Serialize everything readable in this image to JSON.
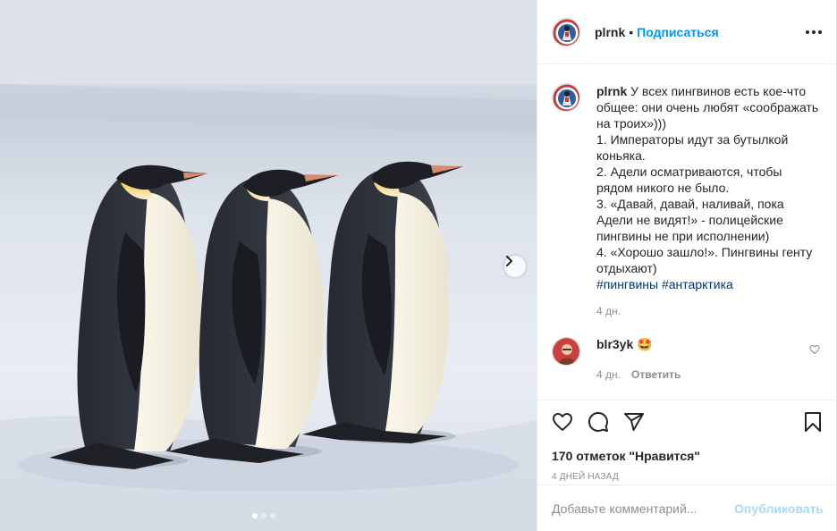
{
  "post": {
    "username": "plrnk",
    "separator": "•",
    "follow_label": "Подписаться",
    "more_label": "Дополнительно"
  },
  "caption": {
    "username": "plrnk",
    "lines": [
      "У всех пингвинов есть кое-что общее: они очень любят «соображать на троих»)))",
      "1. Императоры идут за бутылкой коньяка.",
      "2. Адели осматриваются, чтобы рядом никого не было.",
      "3. «Давай, давай, наливай, пока Адели не видят!» - полицейские пингвины не при исполнении)",
      "4. «Хорошо зашло!». Пингвины генту отдыхают)"
    ],
    "hashtags": [
      "#пингвины",
      "#антарктика"
    ],
    "time": "4 дн."
  },
  "comment": {
    "username": "blr3yk",
    "emoji": "🤩",
    "time": "4 дн.",
    "reply_label": "Ответить"
  },
  "stats": {
    "likes": "170 отметок \"Нравится\"",
    "date": "4 дней назад"
  },
  "composer": {
    "placeholder": "Добавьте комментарий...",
    "publish_label": "Опубликовать"
  },
  "carousel": {
    "slides": 3,
    "active": 0
  },
  "colors": {
    "accent": "#0095f6",
    "link": "#00376b",
    "muted": "#8e8e8e",
    "text": "#262626"
  },
  "icons": [
    "heart-icon",
    "comment-icon",
    "share-icon",
    "bookmark-icon",
    "chevron-right-icon",
    "more-icon"
  ]
}
